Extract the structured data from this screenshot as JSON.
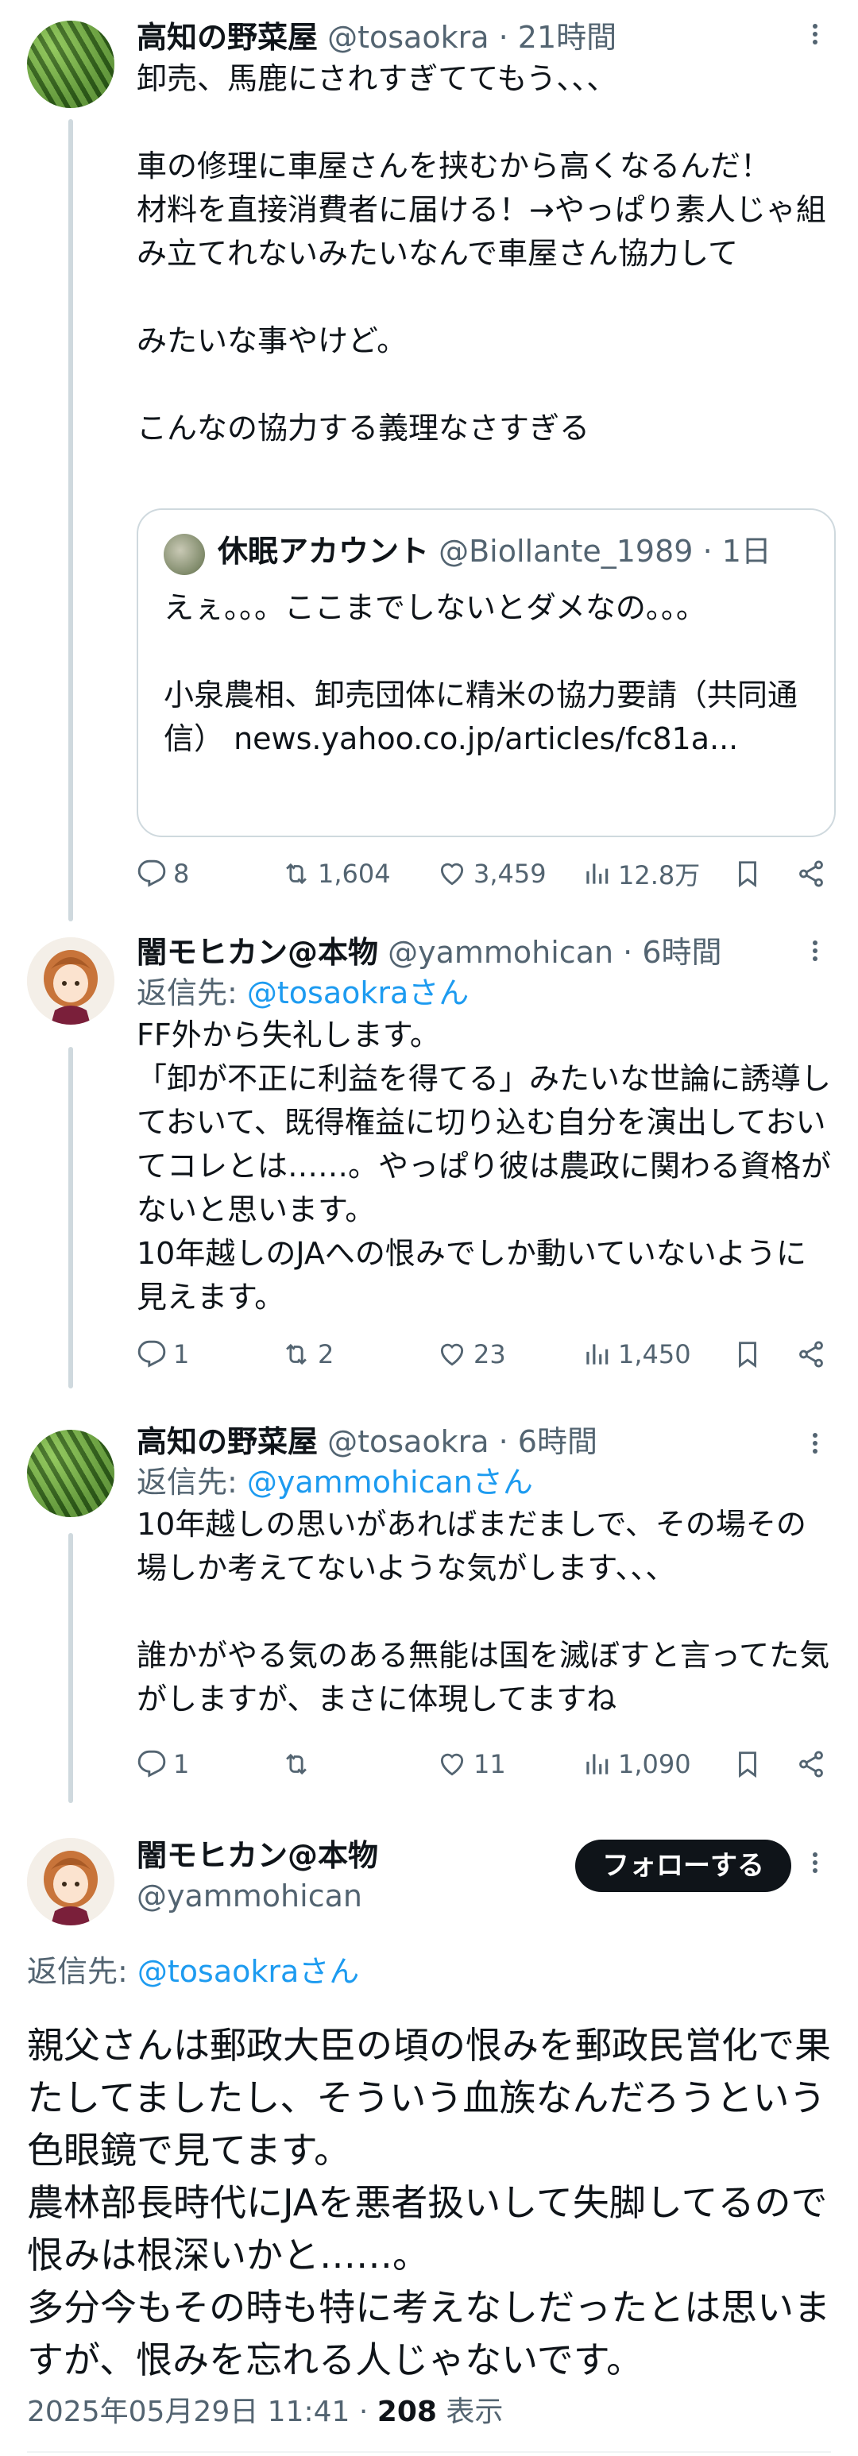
{
  "tweets": [
    {
      "name": "高知の野菜屋",
      "handle": "@tosaokra",
      "time": "· 21時間",
      "text": "卸売、馬鹿にされすぎててもう、、、\n\n車の修理に車屋さんを挟むから高くなるんだ！\n材料を直接消費者に届ける！→やっぱり素人じゃ組み立てれないみたいなんで車屋さん協力して\n\nみたいな事やけど。\n\nこんなの協力する義理なさすぎる",
      "quote": {
        "name": "休眠アカウント",
        "handle": "@Biollante_1989",
        "time": "· 1日",
        "text": "えぇ。。。ここまでしないとダメなの。。。\n\n小泉農相、卸売団体に精米の協力要請（共同通信） news.yahoo.co.jp/articles/fc81a..."
      },
      "replies": "8",
      "retweets": "1,604",
      "likes": "3,459",
      "views": "12.8万"
    },
    {
      "name": "闇モヒカン@本物",
      "handle": "@yammohican",
      "time": "· 6時間",
      "reply_prefix": "返信先: ",
      "reply_to": "@tosaokraさん",
      "text": "FF外から失礼します。\n「卸が不正に利益を得てる」みたいな世論に誘導しておいて、既得権益に切り込む自分を演出しておいてコレとは……。やっぱり彼は農政に関わる資格がないと思います。\n10年越しのJAへの恨みでしか動いていないように見えます。",
      "replies": "1",
      "retweets": "2",
      "likes": "23",
      "views": "1,450"
    },
    {
      "name": "高知の野菜屋",
      "handle": "@tosaokra",
      "time": "· 6時間",
      "reply_prefix": "返信先: ",
      "reply_to": "@yammohicanさん",
      "text": "10年越しの思いがあればまだましで、その場その場しか考えてないような気がします、、、\n\n誰かがやる気のある無能は国を滅ぼすと言ってた気がしますが、まさに体現してますね",
      "replies": "1",
      "retweets": "",
      "likes": "11",
      "views": "1,090"
    }
  ],
  "main": {
    "name": "闇モヒカン@本物",
    "handle": "@yammohican",
    "follow_label": "フォローする",
    "reply_prefix": "返信先: ",
    "reply_to": "@tosaokraさん",
    "text": "親父さんは郵政大臣の頃の恨みを郵政民営化で果たしてましたし、そういう血族なんだろうという色眼鏡で見てます。\n農林部長時代にJAを悪者扱いして失脚してるので恨みは根深いかと……。\n多分今もその時も特に考えなしだったとは思いますが、恨みを忘れる人じゃないです。",
    "datetime": "2025年05月29日 11:41 · ",
    "views_count": "208",
    "views_label": " 表示"
  },
  "colors": {
    "accent": "#1d9bf0",
    "muted": "#536471",
    "text": "#0f1419",
    "line": "#cfd9de"
  },
  "icons": [
    "reply-icon",
    "retweet-icon",
    "like-icon",
    "views-icon",
    "bookmark-icon",
    "share-icon",
    "more-icon"
  ]
}
